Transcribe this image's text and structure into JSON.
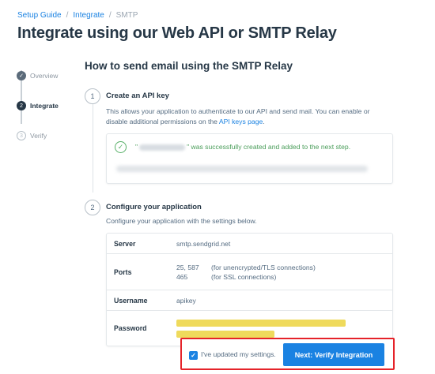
{
  "breadcrumb": {
    "items": [
      "Setup Guide",
      "Integrate",
      "SMTP"
    ],
    "separator": "/"
  },
  "page": {
    "title": "Integrate using our Web API or SMTP Relay"
  },
  "steps": [
    {
      "label": "Overview",
      "state": "done",
      "icon": "check-icon"
    },
    {
      "label": "Integrate",
      "state": "active",
      "number": "2"
    },
    {
      "label": "Verify",
      "state": "todo",
      "number": "3"
    }
  ],
  "section": {
    "title": "How to send email using the SMTP Relay"
  },
  "step1": {
    "number": "1",
    "title": "Create an API key",
    "desc_before_link": "This allows your application to authenticate to our API and send mail. You can enable or disable additional permissions on the ",
    "link": "API keys page",
    "desc_after_link": ".",
    "success_prefix": "\"",
    "success_suffix": "\" was successfully created and added to the next step."
  },
  "step2": {
    "number": "2",
    "title": "Configure your application",
    "desc": "Configure your application with the settings below.",
    "server_label": "Server",
    "server_value": "smtp.sendgrid.net",
    "ports_label": "Ports",
    "ports": [
      {
        "port": "25, 587",
        "note": "(for unencrypted/TLS connections)"
      },
      {
        "port": "465",
        "note": "(for SSL connections)"
      }
    ],
    "username_label": "Username",
    "username_value": "apikey",
    "password_label": "Password"
  },
  "actions": {
    "checkbox_checked": true,
    "checkbox_label": "I've updated my settings.",
    "next_button": "Next: Verify Integration"
  },
  "colors": {
    "accent": "#1a82e2",
    "success": "#58b068",
    "highlight_border": "#e5232a",
    "redaction": "#ecd43f"
  }
}
